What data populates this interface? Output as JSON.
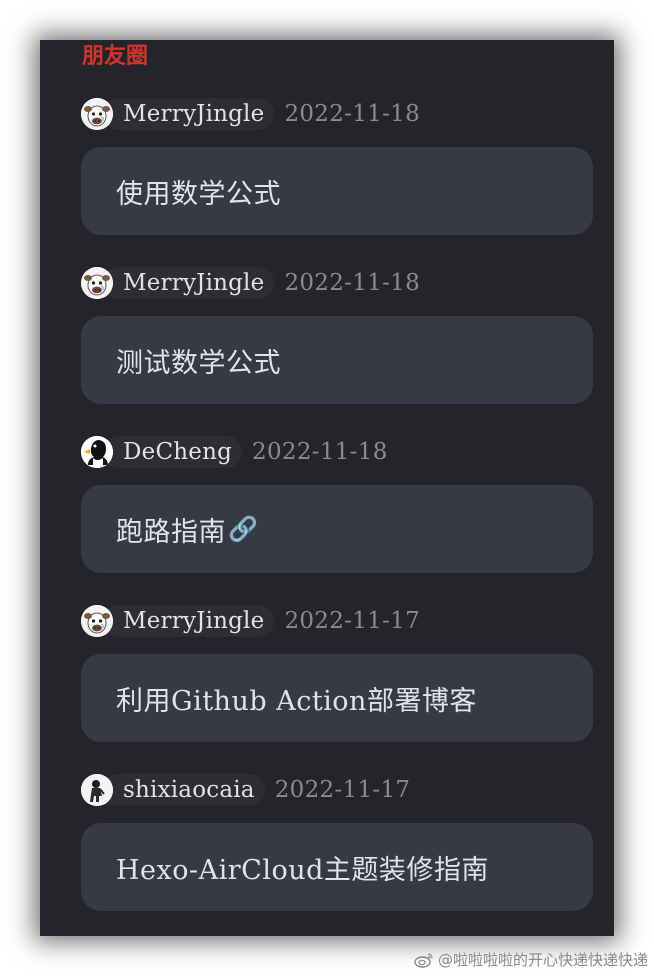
{
  "header": {
    "title": "朋友圈",
    "title_color": "#d4322c"
  },
  "colors": {
    "date": "#8a8a8a",
    "panel_bg": "#24252a",
    "card_bg": "#363a45"
  },
  "posts": [
    {
      "author": "MerryJingle",
      "date": "2022-11-18",
      "content": "使用数学公式",
      "avatar_icon": "cow-avatar-icon"
    },
    {
      "author": "MerryJingle",
      "date": "2022-11-18",
      "content": "测试数学公式",
      "avatar_icon": "cow-avatar-icon"
    },
    {
      "author": "DeCheng",
      "date": "2022-11-18",
      "content": "跑路指南",
      "link_symbol": "🔗",
      "avatar_icon": "duck-avatar-icon"
    },
    {
      "author": "MerryJingle",
      "date": "2022-11-17",
      "content": "利用Github Action部署博客",
      "avatar_icon": "cow-avatar-icon"
    },
    {
      "author": "shixiaocaia",
      "date": "2022-11-17",
      "content": "Hexo-AirCloud主题装修指南",
      "avatar_icon": "figure-avatar-icon"
    }
  ],
  "watermark": {
    "text": "@啦啦啦啦的开心快递快递快递",
    "icon": "weibo-icon"
  }
}
